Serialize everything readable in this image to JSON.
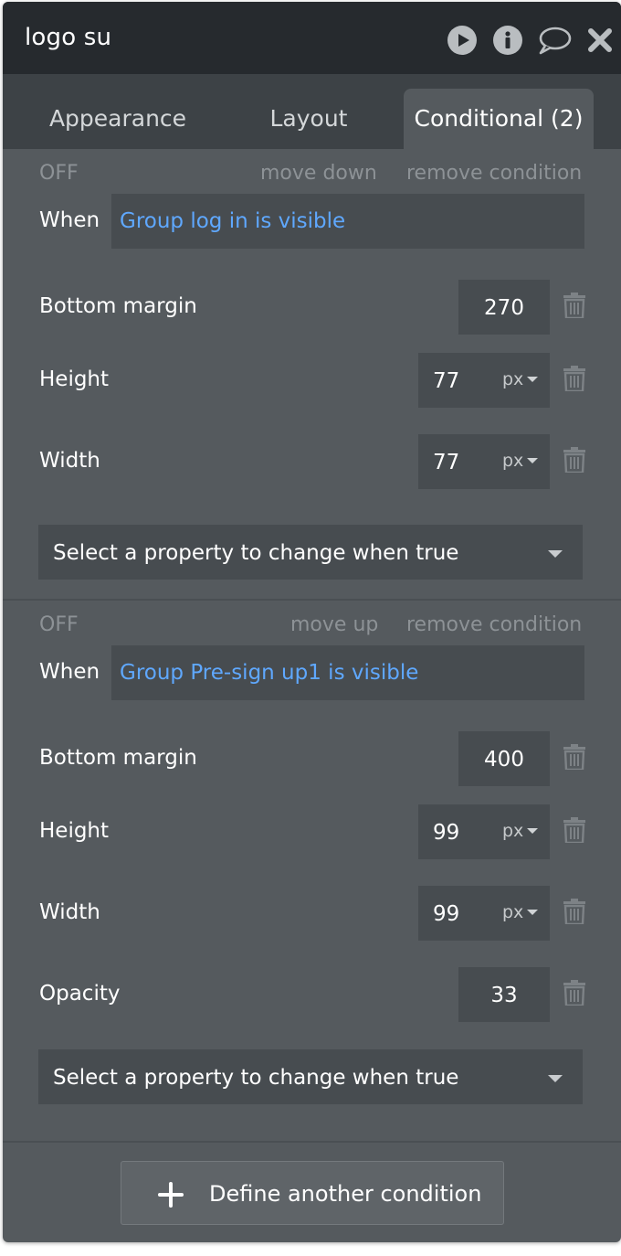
{
  "window": {
    "title": "logo su",
    "icons": [
      "play-icon",
      "info-icon",
      "comment-icon",
      "close-icon"
    ]
  },
  "tabs": [
    {
      "label": "Appearance",
      "active": false
    },
    {
      "label": "Layout",
      "active": false
    },
    {
      "label": "Conditional (2)",
      "active": true
    }
  ],
  "conditions": [
    {
      "status": "OFF",
      "move_label": "move down",
      "remove_label": "remove condition",
      "when_label": "When",
      "expression": "Group log in is visible",
      "properties": [
        {
          "label": "Bottom margin",
          "value": "270"
        },
        {
          "label": "Height",
          "value": "77",
          "unit": "px"
        },
        {
          "label": "Width",
          "value": "77",
          "unit": "px"
        }
      ],
      "select_placeholder": "Select a property to change when true"
    },
    {
      "status": "OFF",
      "move_label": "move up",
      "remove_label": "remove condition",
      "when_label": "When",
      "expression": "Group Pre-sign up1 is visible",
      "properties": [
        {
          "label": "Bottom margin",
          "value": "400"
        },
        {
          "label": "Height",
          "value": "99",
          "unit": "px"
        },
        {
          "label": "Width",
          "value": "99",
          "unit": "px"
        },
        {
          "label": "Opacity",
          "value": "33"
        }
      ],
      "select_placeholder": "Select a property to change when true"
    }
  ],
  "footer": {
    "define_label": "Define another condition"
  },
  "colors": {
    "titlebar": "#262a2e",
    "panel": "#555a5e",
    "field": "#474c50",
    "link_text": "#5fa8ff",
    "muted_text": "#8d9296"
  }
}
